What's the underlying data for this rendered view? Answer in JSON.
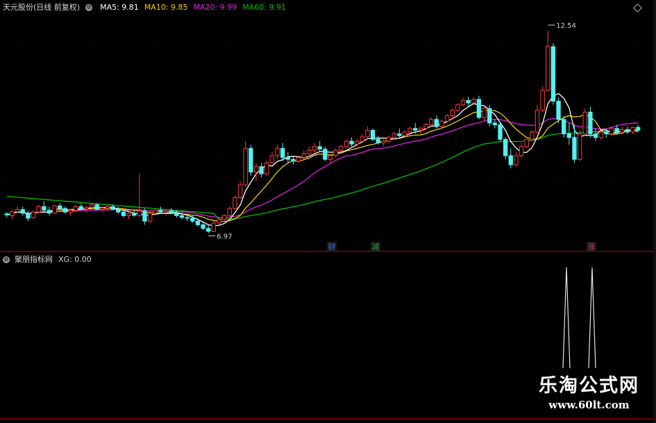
{
  "header": {
    "stock": "天元股份(日线 前复权)",
    "ma5_label": "MA5: 9.81",
    "ma10_label": "MA10: 9.85",
    "ma20_label": "MA20: 9.99",
    "ma60_label": "MA60: 9.91"
  },
  "indicator": {
    "name": "聚朋指标网",
    "xg_label": "XG: 0.00"
  },
  "markers": [
    {
      "text": "财",
      "color": "#3b6fd1"
    },
    {
      "text": "减",
      "color": "#23a12b"
    },
    {
      "text": "涨",
      "color": "#d23a3a"
    }
  ],
  "watermark": {
    "title": "乐淘公式网",
    "url": "www.60lt.com"
  },
  "colors": {
    "up": "#ff3c3c",
    "down": "#54f0f0",
    "ma5": "#ffffff",
    "ma10": "#f0d000",
    "ma20": "#e020e0",
    "ma60": "#00c000",
    "grid": "#8b0000"
  },
  "chart_data": {
    "type": "candlestick",
    "bars": 120,
    "price_ylim": [
      6.6,
      13.0
    ],
    "annotations": [
      {
        "text": "12.54",
        "value": 12.54,
        "kind": "high"
      },
      {
        "text": "6.97",
        "value": 6.97,
        "kind": "low"
      }
    ],
    "series": [
      {
        "name": "MA5",
        "value": 9.81
      },
      {
        "name": "MA10",
        "value": 9.85
      },
      {
        "name": "MA20",
        "value": 9.99
      },
      {
        "name": "MA60",
        "value": 9.91
      }
    ],
    "ohlc": [
      [
        7.5,
        7.55,
        7.4,
        7.47
      ],
      [
        7.45,
        7.6,
        7.35,
        7.56
      ],
      [
        7.56,
        7.7,
        7.5,
        7.62
      ],
      [
        7.62,
        7.7,
        7.45,
        7.52
      ],
      [
        7.5,
        7.58,
        7.3,
        7.38
      ],
      [
        7.4,
        7.6,
        7.35,
        7.55
      ],
      [
        7.55,
        7.75,
        7.5,
        7.7
      ],
      [
        7.7,
        7.85,
        7.55,
        7.6
      ],
      [
        7.6,
        7.7,
        7.45,
        7.52
      ],
      [
        7.52,
        7.75,
        7.5,
        7.72
      ],
      [
        7.72,
        7.8,
        7.6,
        7.65
      ],
      [
        7.65,
        7.7,
        7.5,
        7.55
      ],
      [
        7.55,
        7.65,
        7.45,
        7.6
      ],
      [
        7.6,
        7.75,
        7.55,
        7.7
      ],
      [
        7.7,
        7.78,
        7.6,
        7.64
      ],
      [
        7.64,
        7.72,
        7.55,
        7.68
      ],
      [
        7.68,
        7.8,
        7.6,
        7.75
      ],
      [
        7.75,
        7.8,
        7.6,
        7.62
      ],
      [
        7.62,
        7.7,
        7.55,
        7.66
      ],
      [
        7.66,
        7.74,
        7.58,
        7.7
      ],
      [
        7.7,
        7.76,
        7.6,
        7.62
      ],
      [
        7.62,
        7.7,
        7.5,
        7.55
      ],
      [
        7.55,
        7.62,
        7.4,
        7.45
      ],
      [
        7.45,
        7.55,
        7.35,
        7.5
      ],
      [
        7.5,
        7.6,
        7.42,
        7.46
      ],
      [
        7.46,
        8.6,
        7.4,
        7.58
      ],
      [
        7.58,
        7.65,
        7.2,
        7.3
      ],
      [
        7.3,
        7.6,
        7.25,
        7.52
      ],
      [
        7.52,
        7.65,
        7.45,
        7.6
      ],
      [
        7.6,
        7.7,
        7.5,
        7.55
      ],
      [
        7.55,
        7.62,
        7.45,
        7.58
      ],
      [
        7.58,
        7.66,
        7.5,
        7.52
      ],
      [
        7.52,
        7.6,
        7.4,
        7.45
      ],
      [
        7.45,
        7.55,
        7.35,
        7.4
      ],
      [
        7.4,
        7.5,
        7.3,
        7.38
      ],
      [
        7.38,
        7.45,
        7.25,
        7.3
      ],
      [
        7.3,
        7.38,
        7.15,
        7.2
      ],
      [
        7.2,
        7.28,
        7.05,
        7.1
      ],
      [
        7.1,
        7.18,
        6.97,
        7.02
      ],
      [
        7.02,
        7.3,
        7.0,
        7.25
      ],
      [
        7.25,
        7.4,
        7.2,
        7.35
      ],
      [
        7.35,
        7.5,
        7.3,
        7.45
      ],
      [
        7.45,
        7.7,
        7.42,
        7.65
      ],
      [
        7.65,
        8.0,
        7.6,
        7.95
      ],
      [
        7.95,
        8.4,
        7.9,
        8.3
      ],
      [
        8.3,
        9.5,
        8.25,
        9.3
      ],
      [
        9.3,
        9.4,
        8.55,
        8.65
      ],
      [
        8.65,
        8.9,
        8.4,
        8.8
      ],
      [
        8.8,
        8.9,
        8.5,
        8.6
      ],
      [
        8.6,
        8.95,
        8.55,
        8.9
      ],
      [
        8.9,
        9.2,
        8.85,
        9.1
      ],
      [
        9.1,
        9.4,
        9.0,
        9.3
      ],
      [
        9.3,
        9.45,
        8.95,
        9.05
      ],
      [
        9.05,
        9.2,
        8.9,
        9.0
      ],
      [
        9.0,
        9.1,
        8.85,
        8.95
      ],
      [
        8.95,
        9.1,
        8.9,
        9.05
      ],
      [
        9.05,
        9.25,
        9.0,
        9.15
      ],
      [
        9.15,
        9.35,
        9.05,
        9.25
      ],
      [
        9.25,
        9.45,
        9.15,
        9.35
      ],
      [
        9.35,
        9.5,
        9.2,
        9.28
      ],
      [
        9.28,
        9.35,
        8.95,
        9.0
      ],
      [
        9.0,
        9.15,
        8.9,
        9.1
      ],
      [
        9.1,
        9.3,
        9.05,
        9.25
      ],
      [
        9.25,
        9.4,
        9.15,
        9.35
      ],
      [
        9.35,
        9.55,
        9.3,
        9.5
      ],
      [
        9.5,
        9.6,
        9.35,
        9.42
      ],
      [
        9.42,
        9.55,
        9.35,
        9.5
      ],
      [
        9.5,
        9.7,
        9.45,
        9.62
      ],
      [
        9.62,
        9.9,
        9.55,
        9.8
      ],
      [
        9.8,
        9.85,
        9.5,
        9.55
      ],
      [
        9.55,
        9.65,
        9.4,
        9.45
      ],
      [
        9.45,
        9.55,
        9.35,
        9.5
      ],
      [
        9.5,
        9.65,
        9.45,
        9.6
      ],
      [
        9.6,
        9.75,
        9.55,
        9.7
      ],
      [
        9.7,
        9.85,
        9.6,
        9.65
      ],
      [
        9.65,
        9.8,
        9.6,
        9.75
      ],
      [
        9.75,
        9.9,
        9.65,
        9.85
      ],
      [
        9.85,
        10.0,
        9.7,
        9.8
      ],
      [
        9.8,
        9.9,
        9.7,
        9.85
      ],
      [
        9.85,
        10.0,
        9.8,
        9.95
      ],
      [
        9.95,
        10.15,
        9.9,
        10.1
      ],
      [
        10.1,
        10.2,
        9.85,
        9.9
      ],
      [
        9.9,
        10.1,
        9.85,
        10.05
      ],
      [
        10.05,
        10.25,
        10.0,
        10.2
      ],
      [
        10.2,
        10.4,
        10.1,
        10.35
      ],
      [
        10.35,
        10.55,
        10.3,
        10.5
      ],
      [
        10.5,
        10.7,
        10.45,
        10.62
      ],
      [
        10.62,
        10.72,
        10.45,
        10.55
      ],
      [
        10.55,
        10.7,
        10.5,
        10.65
      ],
      [
        10.65,
        10.75,
        10.1,
        10.15
      ],
      [
        10.15,
        10.45,
        10.05,
        10.4
      ],
      [
        10.4,
        10.5,
        9.9,
        10.0
      ],
      [
        10.0,
        10.1,
        9.85,
        9.95
      ],
      [
        9.95,
        10.0,
        9.5,
        9.55
      ],
      [
        9.55,
        9.6,
        9.0,
        9.1
      ],
      [
        9.1,
        9.3,
        8.75,
        8.85
      ],
      [
        8.85,
        9.2,
        8.8,
        9.1
      ],
      [
        9.1,
        9.45,
        9.05,
        9.35
      ],
      [
        9.35,
        9.6,
        9.3,
        9.55
      ],
      [
        9.55,
        9.8,
        9.5,
        9.75
      ],
      [
        9.75,
        10.5,
        9.7,
        10.35
      ],
      [
        10.35,
        11.0,
        10.3,
        10.9
      ],
      [
        10.9,
        12.54,
        10.85,
        12.1
      ],
      [
        12.1,
        12.2,
        10.5,
        10.6
      ],
      [
        10.6,
        10.7,
        10.0,
        10.1
      ],
      [
        10.1,
        10.2,
        9.6,
        9.7
      ],
      [
        9.7,
        10.0,
        9.4,
        9.6
      ],
      [
        9.6,
        9.95,
        8.9,
        9.0
      ],
      [
        9.0,
        9.8,
        8.95,
        9.7
      ],
      [
        9.7,
        10.4,
        9.65,
        10.3
      ],
      [
        10.3,
        10.45,
        9.6,
        9.7
      ],
      [
        9.7,
        9.85,
        9.5,
        9.6
      ],
      [
        9.6,
        9.8,
        9.55,
        9.75
      ],
      [
        9.75,
        9.85,
        9.6,
        9.7
      ],
      [
        9.7,
        9.9,
        9.65,
        9.85
      ],
      [
        9.85,
        9.95,
        9.7,
        9.75
      ],
      [
        9.75,
        9.9,
        9.7,
        9.82
      ],
      [
        9.82,
        9.9,
        9.7,
        9.75
      ],
      [
        9.75,
        9.9,
        9.7,
        9.88
      ],
      [
        9.88,
        9.95,
        9.75,
        9.8
      ]
    ],
    "xg_peaks": [
      {
        "bar": 112,
        "value": 1
      },
      {
        "bar": 117,
        "value": 1
      }
    ]
  }
}
